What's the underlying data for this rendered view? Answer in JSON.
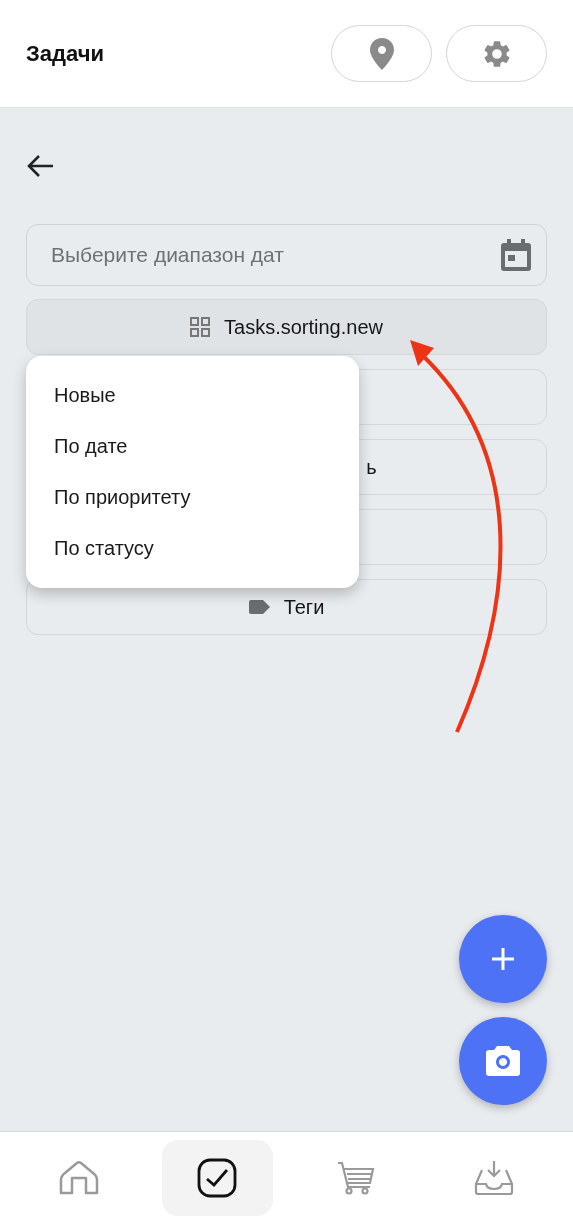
{
  "header": {
    "title": "Задачи"
  },
  "date_field": {
    "placeholder": "Выберите диапазон дат"
  },
  "sort_button": {
    "label": "Tasks.sorting.new",
    "expanded": true
  },
  "sort_menu": {
    "items": [
      {
        "label": "Новые",
        "selected": false
      },
      {
        "label": "По дате",
        "selected": false
      },
      {
        "label": "По приоритету",
        "selected": false
      },
      {
        "label": "По статусу",
        "selected": false
      }
    ]
  },
  "filter_buttons": [
    {
      "kind": "blank"
    },
    {
      "kind": "clipped",
      "label": "ь"
    },
    {
      "kind": "blank"
    },
    {
      "kind": "tag",
      "label": "Теги"
    }
  ],
  "nav": [
    {
      "kind": "home",
      "selected": false
    },
    {
      "kind": "tasks",
      "selected": true
    },
    {
      "kind": "cart",
      "selected": false
    },
    {
      "kind": "inbox",
      "selected": false
    }
  ]
}
